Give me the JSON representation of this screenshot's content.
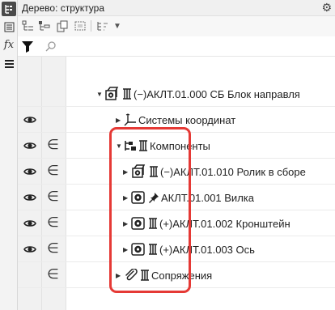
{
  "window": {
    "title": "Дерево: структура"
  },
  "left_toolbar": {
    "fx_label": "fx"
  },
  "search": {
    "placeholder": ""
  },
  "tree": {
    "root": {
      "label": "(−)АКЛТ.01.000 СБ Блок направля"
    },
    "coord_systems": {
      "label": "Системы координат"
    },
    "components": {
      "label": "Компоненты"
    },
    "items": [
      {
        "label": "(−)АКЛТ.01.010 Ролик в сборе"
      },
      {
        "label": "АКЛТ.01.001 Вилка"
      },
      {
        "label": "(+)АКЛТ.01.002 Кронштейн"
      },
      {
        "label": "(+)АКЛТ.01.003 Ось"
      }
    ],
    "mates": {
      "label": "Сопряжения"
    }
  },
  "colors": {
    "highlight": "#e53935",
    "accent": "#333333"
  }
}
